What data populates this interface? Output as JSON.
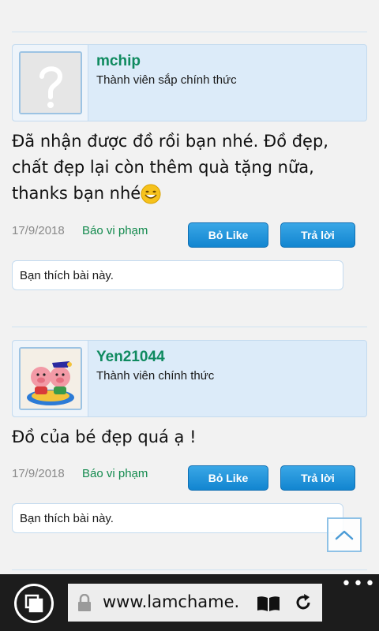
{
  "posts": [
    {
      "username": "mchip",
      "rank": "Thành viên sắp chính thức",
      "avatar": "question-placeholder",
      "content": "Đã nhận được đồ rồi bạn nhé. Đồ đẹp, chất đẹp lại còn thêm quà tặng nữa, thanks bạn nhé",
      "date": "17/9/2018",
      "report_label": "Báo vi phạm",
      "like_label": "Bỏ Like",
      "reply_label": "Trả lời",
      "liked_text": "Bạn thích bài này."
    },
    {
      "username": "Yen21044",
      "rank": "Thành viên chính thức",
      "avatar": "piggy-figurine-photo",
      "content": "Đồ của bé đẹp quá ạ !",
      "date": "17/9/2018",
      "report_label": "Báo vi phạm",
      "like_label": "Bỏ Like",
      "reply_label": "Trả lời",
      "liked_text": "Bạn thích bài này."
    }
  ],
  "browser": {
    "url": "www.lamchame.",
    "tabs_icon": "tabs-icon",
    "lock_icon": "lock-icon",
    "reading_icon": "reading-view-icon",
    "refresh_icon": "refresh-icon",
    "more_icon": "more-dots-icon"
  },
  "colors": {
    "username": "#0f8a5f",
    "button": "#1a8fd8",
    "card_bg": "#dcebf9"
  }
}
